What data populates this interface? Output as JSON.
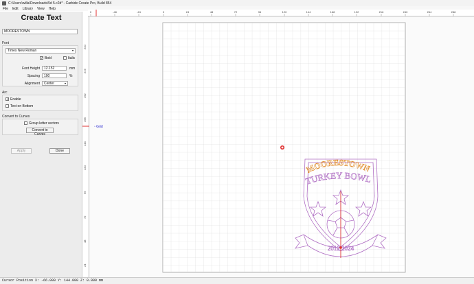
{
  "window": {
    "title": "C:\\Users\\willa\\Downloads\\5d 5.c2d* - Carbide Create Pro, Build 854"
  },
  "menu": [
    "File",
    "Edit",
    "Library",
    "View",
    "Help"
  ],
  "panel": {
    "heading": "Create Text",
    "text_value": "MOORESTOWN",
    "font_section": "Font",
    "font_name": "Times New Roman",
    "bold_label": "Bold",
    "bold_checked": true,
    "italic_label": "Italic",
    "italic_checked": false,
    "font_height_label": "Font Height",
    "font_height_value": "12.152",
    "font_height_unit": "mm",
    "spacing_label": "Spacing",
    "spacing_value": "100",
    "spacing_unit": "%",
    "alignment_label": "Alignment",
    "alignment_value": "Center",
    "arc_section": "Arc",
    "enable_label": "Enable",
    "enable_checked": true,
    "text_on_bottom_label": "Text on Bottom",
    "text_on_bottom_checked": false,
    "convert_section": "Convert to Curves",
    "group_vectors_label": "Group letter vectors",
    "group_vectors_checked": false,
    "convert_button": "Convert to Curves",
    "apply_button": "Apply",
    "done_button": "Done"
  },
  "rulers": {
    "top_ticks": [
      "0",
      "-48",
      "-24",
      "0",
      "24",
      "48",
      "72",
      "96",
      "120",
      "144",
      "168",
      "192",
      "216",
      "240",
      "264",
      "288"
    ],
    "left_ticks": [
      "240",
      "216",
      "192",
      "168",
      "144",
      "120",
      "96",
      "72",
      "48",
      "24"
    ]
  },
  "canvas": {
    "grid_label": "Grid",
    "design_top_text": "MOORESTOWN",
    "design_middle_text": "TURKEY BOWL",
    "design_bottom_text": "2012 2024",
    "colors": {
      "grid_line": "#d7d7d7",
      "design_stroke": "#b06fc4",
      "highlight_text": "#e08c2a",
      "origin_line": "#e03030"
    }
  },
  "status": {
    "cursor_text": "Cursor Position X: -66.000 Y: 144.000 Z: 0.000 mm"
  }
}
